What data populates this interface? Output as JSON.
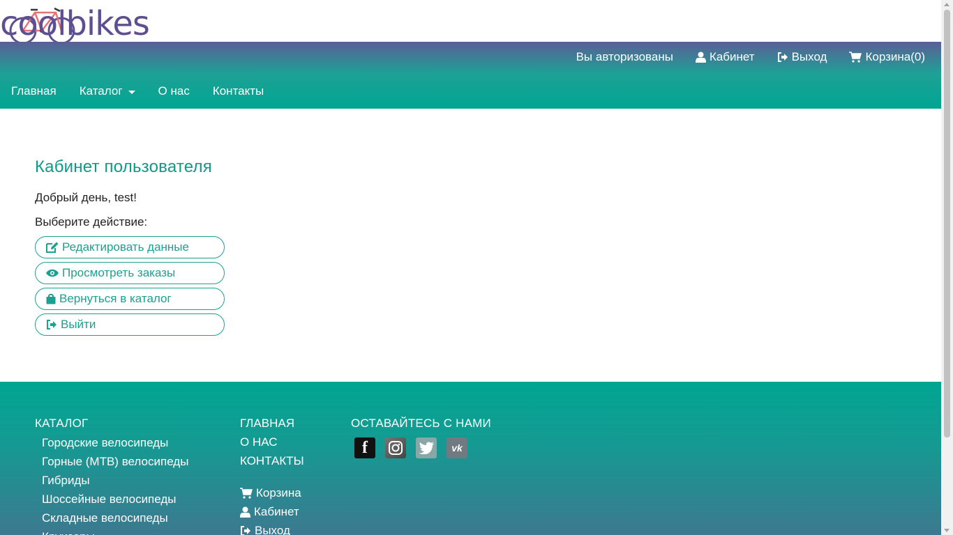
{
  "logo": {
    "text": "coolbikes"
  },
  "topnav": {
    "status": "Вы авторизованы",
    "cabinet": "Кабинет",
    "logout": "Выход",
    "cart": "Корзина(0)",
    "main_links": [
      "Главная",
      "Каталог",
      "О нас",
      "Контакты"
    ]
  },
  "main": {
    "title": "Кабинет пользователя",
    "greeting": "Добрый день, test!",
    "prompt": "Выберите действие:",
    "buttons": [
      {
        "label": "Редактировать данные",
        "icon": "edit-icon"
      },
      {
        "label": "Просмотреть заказы",
        "icon": "eye-icon"
      },
      {
        "label": "Вернуться в каталог",
        "icon": "shopping-bag-icon"
      },
      {
        "label": "Выйти",
        "icon": "sign-out-icon"
      }
    ]
  },
  "footer": {
    "catalog_heading": "КАТАЛОГ",
    "catalog_items": [
      "Городские велосипеды",
      "Горные (MTB) велосипеды",
      "Гибриды",
      "Шоссейные велосипеды",
      "Складные велосипеды",
      "Круизеры"
    ],
    "nav_items": [
      "ГЛАВНАЯ",
      "О НАС",
      "КОНТАКТЫ"
    ],
    "user_items": [
      "Корзина",
      "Кабинет",
      "Выход"
    ],
    "social_heading": "ОСТАВАЙТЕСЬ С НАМИ",
    "social": [
      {
        "name": "facebook",
        "glyph": "f",
        "color": "#111111"
      },
      {
        "name": "instagram",
        "glyph": "",
        "color": "#555555"
      },
      {
        "name": "twitter",
        "glyph": "",
        "color": "#8aa7a8"
      },
      {
        "name": "vk",
        "glyph": "vk",
        "color": "#707a80"
      }
    ]
  },
  "colors": {
    "accent": "#1aa190",
    "logo": "#5e4f93",
    "nav_top": "#5a5e95",
    "nav_bottom": "#00a592"
  }
}
